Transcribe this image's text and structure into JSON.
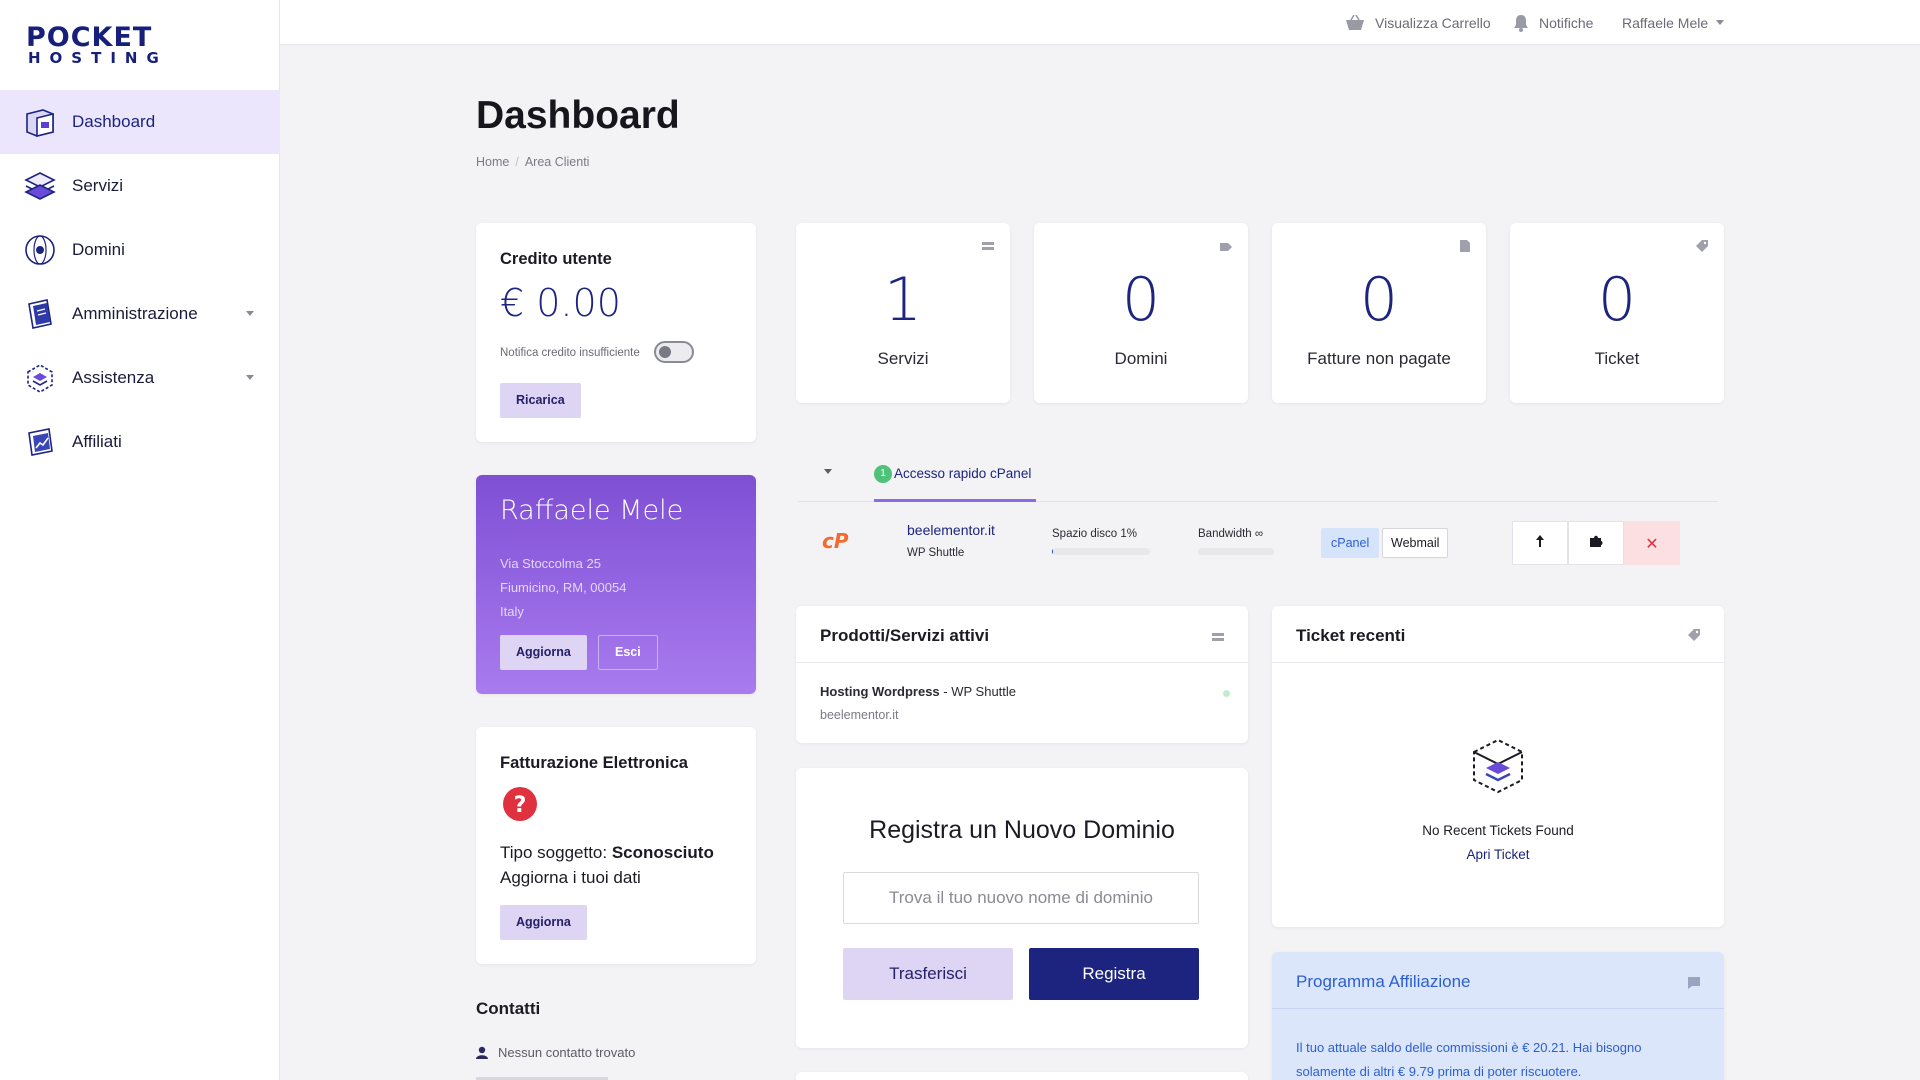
{
  "logo": {
    "line1": "POCKET",
    "line2": "HOSTING"
  },
  "sidebar": {
    "items": [
      {
        "label": "Dashboard",
        "icon": "dashboard-icon",
        "active": true
      },
      {
        "label": "Servizi",
        "icon": "layers-icon"
      },
      {
        "label": "Domini",
        "icon": "globe-icon"
      },
      {
        "label": "Amministrazione",
        "icon": "book-icon",
        "dropdown": true
      },
      {
        "label": "Assistenza",
        "icon": "support-box-icon",
        "dropdown": true
      },
      {
        "label": "Affiliati",
        "icon": "chart-card-icon"
      }
    ]
  },
  "topbar": {
    "cart": "Visualizza Carrello",
    "notifications": "Notifiche",
    "user": "Raffaele Mele"
  },
  "page": {
    "title": "Dashboard",
    "breadcrumb": [
      "Home",
      "Area Clienti"
    ]
  },
  "credit": {
    "title": "Credito utente",
    "amount": "€ 0.00",
    "toggle_label": "Notifica credito insufficiente",
    "toggle_on": false,
    "button": "Ricarica"
  },
  "profile": {
    "name": "Raffaele Mele",
    "address1": "Via Stoccolma 25",
    "address2": "Fiumicino, RM, 00054",
    "country": "Italy",
    "update_button": "Aggiorna",
    "logout_button": "Esci"
  },
  "einvoice": {
    "title": "Fatturazione Elettronica",
    "subject_label": "Tipo soggetto: ",
    "subject_value": "Sconosciuto",
    "update_text": "Aggiorna i tuoi dati",
    "button": "Aggiorna"
  },
  "contacts": {
    "title": "Contatti",
    "empty": "Nessun contatto trovato"
  },
  "stats": [
    {
      "value": "1",
      "label": "Servizi",
      "icon": "server-icon"
    },
    {
      "value": "0",
      "label": "Domini",
      "icon": "tag-icon"
    },
    {
      "value": "0",
      "label": "Fatture non pagate",
      "icon": "document-icon"
    },
    {
      "value": "0",
      "label": "Ticket",
      "icon": "ticket-icon"
    }
  ],
  "cpanel": {
    "tab_badge": "1",
    "tab_label": "Accesso rapido cPanel",
    "domain": "beelementor.it",
    "plan": "WP Shuttle",
    "disk_label": "Spazio disco 1%",
    "disk_percent": 1,
    "bandwidth_label": "Bandwidth ∞",
    "bandwidth_percent": 0,
    "cpanel_button": "cPanel",
    "webmail_button": "Webmail",
    "accent": "#f26a2e"
  },
  "products": {
    "title": "Prodotti/Servizi attivi",
    "item_name": "Hosting Wordpress",
    "item_plan": " - WP Shuttle",
    "item_domain": "beelementor.it"
  },
  "tickets": {
    "title": "Ticket recenti",
    "empty": "No Recent Tickets Found",
    "link": "Apri Ticket"
  },
  "register": {
    "title": "Registra un Nuovo Dominio",
    "placeholder": "Trova il tuo nuovo nome di dominio",
    "transfer_button": "Trasferisci",
    "register_button": "Registra"
  },
  "affiliate": {
    "title": "Programma Affiliazione",
    "text_line1": "Il tuo attuale saldo delle commissioni è € 20.21. Hai bisogno",
    "text_line2": "solamente di altri € 9.79 prima di poter riscuotere."
  },
  "colors": {
    "primary": "#1c2480",
    "soft_purple": "#ddd5f3",
    "profile_gradient_top": "#7f4fd4",
    "profile_gradient_bottom": "#a97bef",
    "affiliate_bg": "#dce6fb",
    "danger": "#e0313f"
  }
}
